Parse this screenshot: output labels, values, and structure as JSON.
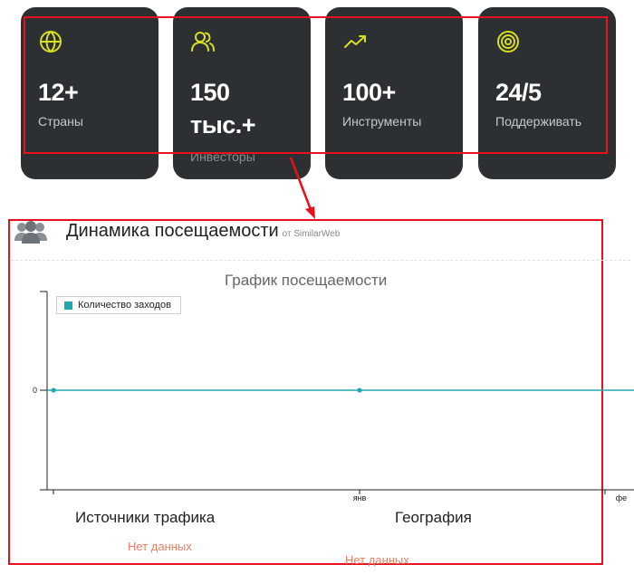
{
  "stats": [
    {
      "icon": "globe-icon",
      "value": "12+",
      "label": "Страны"
    },
    {
      "icon": "users-icon",
      "value": "150 тыс.+",
      "label": "Инвесторы"
    },
    {
      "icon": "trending-up-icon",
      "value": "100+",
      "label": "Инструменты"
    },
    {
      "icon": "target-icon",
      "value": "24/5",
      "label": "Поддерживать"
    }
  ],
  "colors": {
    "card_bg": "#2d3032",
    "icon_accent": "#d9e021",
    "highlight": "#e8101c",
    "series": "#20a8b0",
    "no_data": "#e98060"
  },
  "traffic": {
    "title": "Динамика посещаемости",
    "source": "от SimilarWeb"
  },
  "chart_data": {
    "type": "line",
    "title": "График посещаемости",
    "series": [
      {
        "name": "Количество заходов",
        "values": [
          0,
          0
        ]
      }
    ],
    "x_tick_labels": [
      "",
      "янв",
      "фе"
    ],
    "y_tick_labels": [
      "0"
    ],
    "legend": "top-left",
    "grid": false
  },
  "sources": {
    "heading": "Источники трафика",
    "empty": "Нет данных"
  },
  "geography": {
    "heading": "География",
    "empty": "Нет данных"
  }
}
